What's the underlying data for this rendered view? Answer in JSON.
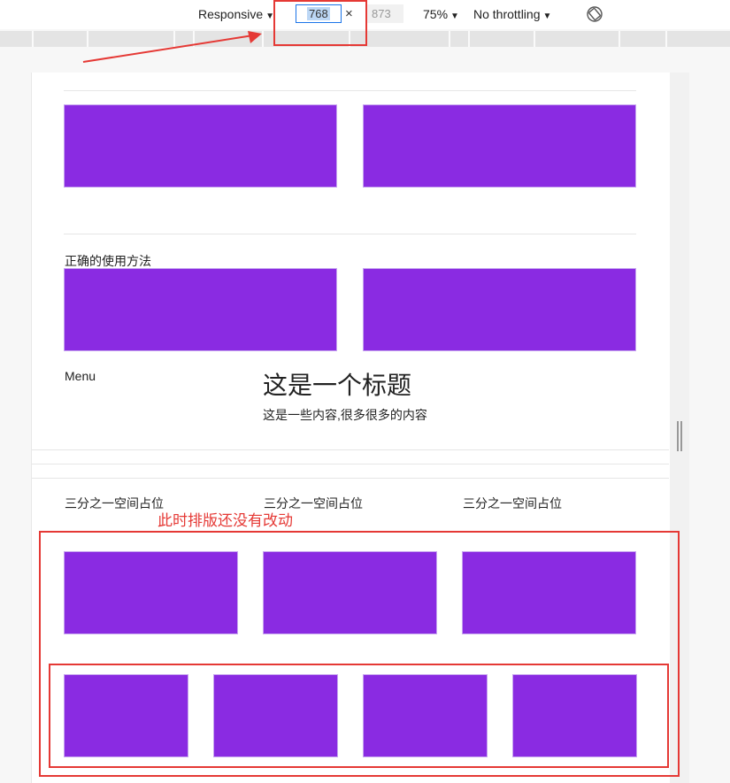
{
  "toolbar": {
    "device": "Responsive",
    "width": "768",
    "close": "×",
    "height": "873",
    "zoom": "75%",
    "throttling": "No throttling",
    "caret": "▼"
  },
  "page": {
    "section_title": "正确的使用方法",
    "menu": "Menu",
    "heading": "这是一个标题",
    "content": "这是一些内容,很多很多的内容",
    "third_labels": [
      "三分之一空间占位",
      "三分之一空间占位",
      "三分之一空间占位"
    ]
  },
  "annotation": {
    "note": "此时排版还没有改动",
    "color": "#e53935"
  },
  "colors": {
    "box": "#8a2be2"
  }
}
